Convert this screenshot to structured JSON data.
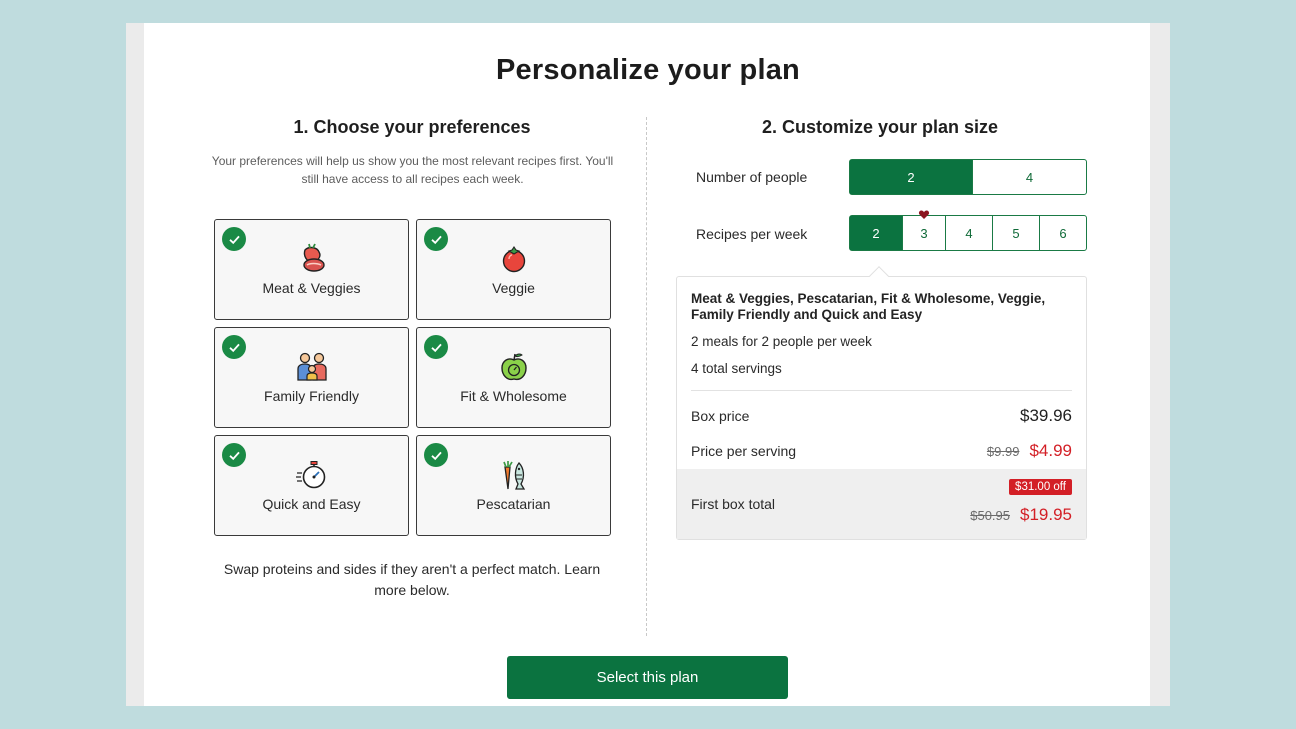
{
  "page": {
    "title": "Personalize your plan"
  },
  "preferences": {
    "heading": "1. Choose your preferences",
    "subtext": "Your preferences will help us show you the most relevant recipes first. You'll still have access to all recipes each week.",
    "items": [
      {
        "label": "Meat & Veggies",
        "icon": "steak-icon",
        "selected": true
      },
      {
        "label": "Veggie",
        "icon": "tomato-icon",
        "selected": true
      },
      {
        "label": "Family Friendly",
        "icon": "family-icon",
        "selected": true
      },
      {
        "label": "Fit & Wholesome",
        "icon": "apple-icon",
        "selected": true
      },
      {
        "label": "Quick and Easy",
        "icon": "stopwatch-icon",
        "selected": true
      },
      {
        "label": "Pescatarian",
        "icon": "fish-carrot-icon",
        "selected": true
      }
    ],
    "swap_note": "Swap proteins and sides if they aren't a perfect match. Learn more below."
  },
  "plan": {
    "heading": "2. Customize your plan size",
    "people": {
      "label": "Number of people",
      "options": [
        "2",
        "4"
      ],
      "selected": "2"
    },
    "recipes": {
      "label": "Recipes per week",
      "options": [
        "2",
        "3",
        "4",
        "5",
        "6"
      ],
      "selected": "2",
      "favorite": "3"
    },
    "summary": {
      "title": "Meat & Veggies, Pescatarian, Fit & Wholesome, Veggie, Family Friendly and Quick and Easy",
      "meals": "2 meals for 2 people per week",
      "servings": "4 total servings",
      "box_price_label": "Box price",
      "box_price": "$39.96",
      "per_serving_label": "Price per serving",
      "per_serving_old": "$9.99",
      "per_serving_new": "$4.99",
      "first_box_label": "First box total",
      "discount_badge": "$31.00 off",
      "first_box_old": "$50.95",
      "first_box_new": "$19.95"
    }
  },
  "cta": {
    "label": "Select this plan"
  },
  "colors": {
    "brand_green": "#0b7340",
    "check_green": "#1a8a45",
    "sale_red": "#d31f26",
    "background": "#bfdcde"
  }
}
